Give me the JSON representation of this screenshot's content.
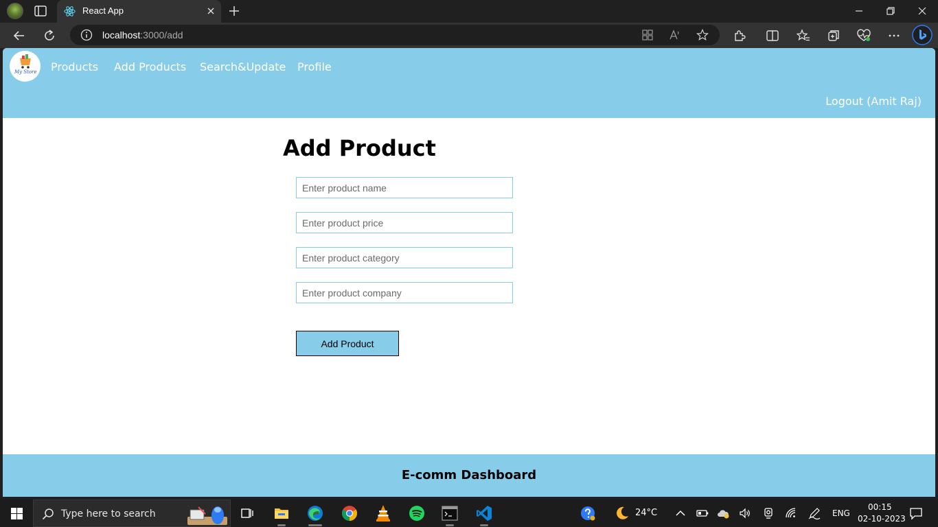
{
  "browser": {
    "tab_title": "React App",
    "url_host": "localhost",
    "url_path": ":3000/add"
  },
  "app": {
    "nav": {
      "logo_text": "My Store",
      "links": [
        "Products",
        "Add Products",
        "Search&Update",
        "Profile"
      ],
      "logout": "Logout (Amit Raj)"
    },
    "page_title": "Add Product",
    "form": {
      "name_placeholder": "Enter product name",
      "price_placeholder": "Enter product price",
      "category_placeholder": "Enter product category",
      "company_placeholder": "Enter product company",
      "submit_label": "Add Product"
    },
    "footer": "E-comm Dashboard",
    "accent_color": "#87cdea"
  },
  "taskbar": {
    "search_placeholder": "Type here to search",
    "weather": "24°C",
    "language": "ENG",
    "time": "00:15",
    "date": "02-10-2023",
    "apps": [
      "task-view",
      "file-explorer",
      "edge",
      "chrome",
      "vlc",
      "spotify",
      "terminal",
      "vscode"
    ]
  }
}
